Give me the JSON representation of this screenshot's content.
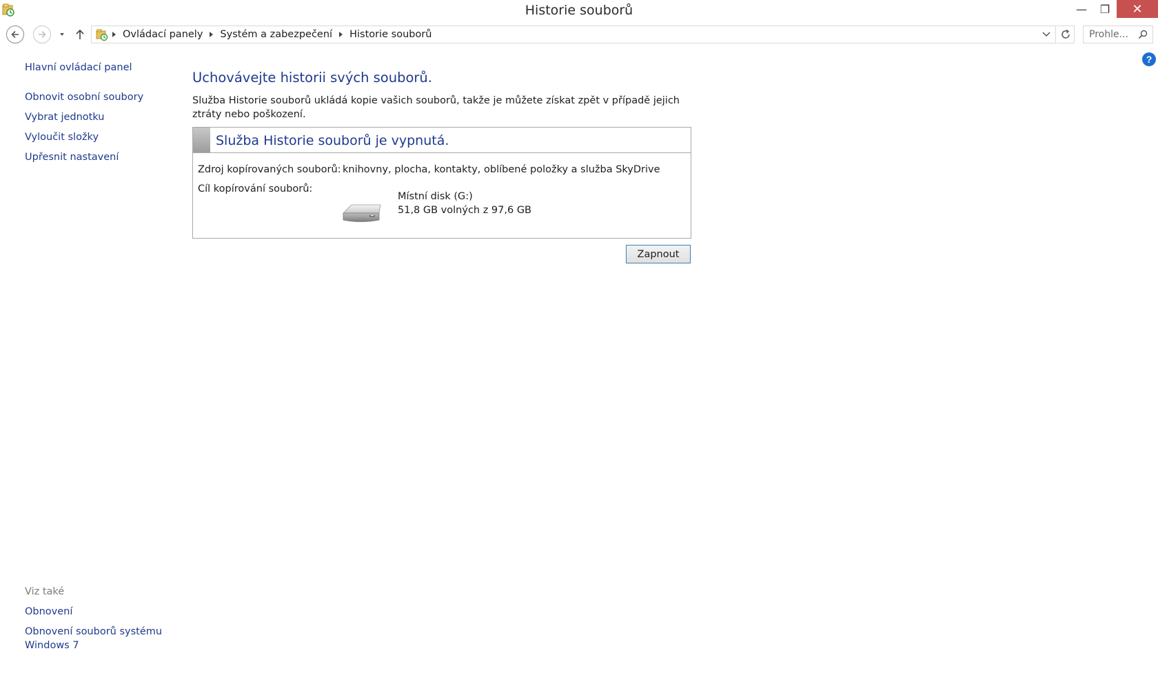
{
  "window": {
    "title": "Historie souborů",
    "minimize_glyph": "—",
    "maximize_glyph": "❐",
    "close_glyph": "✕"
  },
  "navigation": {
    "breadcrumbs": [
      "Ovládací panely",
      "Systém a zabezpečení",
      "Historie souborů"
    ],
    "search_placeholder": "Prohle..."
  },
  "sidebar": {
    "main_link": "Hlavní ovládací panel",
    "links": [
      "Obnovit osobní soubory",
      "Vybrat jednotku",
      "Vyloučit složky",
      "Upřesnit nastavení"
    ],
    "see_also_label": "Viz také",
    "see_also_links": [
      "Obnovení",
      "Obnovení souborů systému",
      "Windows 7"
    ]
  },
  "main": {
    "heading": "Uchovávejte historii svých souborů.",
    "description": "Služba Historie souborů ukládá kopie vašich souborů, takže je můžete získat zpět v případě jejich ztráty nebo poškození.",
    "status_title": "Služba Historie souborů je vypnutá.",
    "source_label": "Zdroj kopírovaných souborů:",
    "source_value": "knihovny, plocha, kontakty, oblíbené položky a služba SkyDrive",
    "target_label": "Cíl kopírování souborů:",
    "drive_name": "Místní disk (G:)",
    "drive_space": "51,8 GB volných z 97,6 GB",
    "turn_on_button": "Zapnout"
  },
  "help_glyph": "?",
  "colors": {
    "link": "#1e3a8c",
    "close_button": "#c75050",
    "help_icon": "#1c6fd0",
    "see_also": "#7a7a7a"
  }
}
